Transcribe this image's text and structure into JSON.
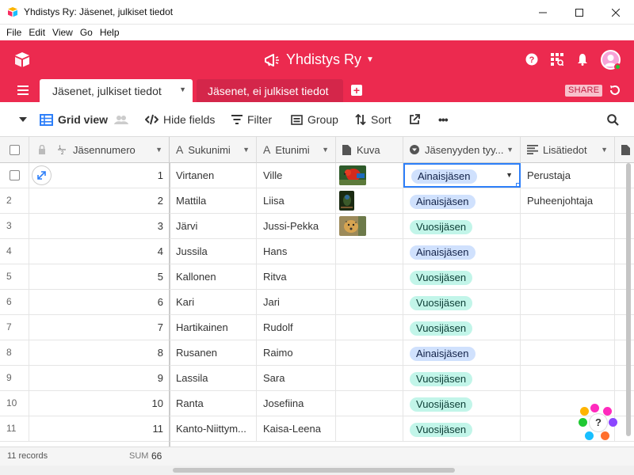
{
  "window": {
    "title": "Yhdistys Ry: Jäsenet, julkiset tiedot",
    "min": "—",
    "max": "☐",
    "close": "✕"
  },
  "menu": [
    "File",
    "Edit",
    "View",
    "Go",
    "Help"
  ],
  "header": {
    "base_name": "Yhdistys Ry",
    "colors": {
      "brand": "#ec2a4f"
    }
  },
  "tabs": {
    "active": "Jäsenet, julkiset tiedot",
    "inactive": "Jäsenet, ei julkiset tiedot",
    "share": "SHARE"
  },
  "toolbar": {
    "view": "Grid view",
    "hide_fields": "Hide fields",
    "filter": "Filter",
    "group": "Group",
    "sort": "Sort",
    "more": "•••"
  },
  "columns": [
    "Jäsennumero",
    "Sukunimi",
    "Etunimi",
    "Kuva",
    "Jäsenyyden tyy...",
    "Lisätiedot"
  ],
  "rows": [
    {
      "idx": "1",
      "num": "1",
      "sukunimi": "Virtanen",
      "etunimi": "Ville",
      "tyyppi": "Ainaisjäsen",
      "lisa": "Perustaja",
      "image": "parrot"
    },
    {
      "idx": "2",
      "num": "2",
      "sukunimi": "Mattila",
      "etunimi": "Liisa",
      "tyyppi": "Ainaisjäsen",
      "lisa": "Puheenjohtaja",
      "image": "bird"
    },
    {
      "idx": "3",
      "num": "3",
      "sukunimi": "Järvi",
      "etunimi": "Jussi-Pekka",
      "tyyppi": "Vuosijäsen",
      "lisa": "",
      "image": "cheetah"
    },
    {
      "idx": "4",
      "num": "4",
      "sukunimi": "Jussila",
      "etunimi": "Hans",
      "tyyppi": "Ainaisjäsen",
      "lisa": "",
      "image": ""
    },
    {
      "idx": "5",
      "num": "5",
      "sukunimi": "Kallonen",
      "etunimi": "Ritva",
      "tyyppi": "Vuosijäsen",
      "lisa": "",
      "image": ""
    },
    {
      "idx": "6",
      "num": "6",
      "sukunimi": "Kari",
      "etunimi": "Jari",
      "tyyppi": "Vuosijäsen",
      "lisa": "",
      "image": ""
    },
    {
      "idx": "7",
      "num": "7",
      "sukunimi": "Hartikainen",
      "etunimi": "Rudolf",
      "tyyppi": "Vuosijäsen",
      "lisa": "",
      "image": ""
    },
    {
      "idx": "8",
      "num": "8",
      "sukunimi": "Rusanen",
      "etunimi": "Raimo",
      "tyyppi": "Ainaisjäsen",
      "lisa": "",
      "image": ""
    },
    {
      "idx": "9",
      "num": "9",
      "sukunimi": "Lassila",
      "etunimi": "Sara",
      "tyyppi": "Vuosijäsen",
      "lisa": "",
      "image": ""
    },
    {
      "idx": "10",
      "num": "10",
      "sukunimi": "Ranta",
      "etunimi": "Josefiina",
      "tyyppi": "Vuosijäsen",
      "lisa": "",
      "image": ""
    },
    {
      "idx": "11",
      "num": "11",
      "sukunimi": "Kanto-Niittym...",
      "etunimi": "Kaisa-Leena",
      "tyyppi": "Vuosijäsen",
      "lisa": "",
      "image": ""
    }
  ],
  "footer": {
    "records": "11 records",
    "sum_label": "SUM",
    "sum_value": "66"
  },
  "help": {
    "label": "?"
  }
}
